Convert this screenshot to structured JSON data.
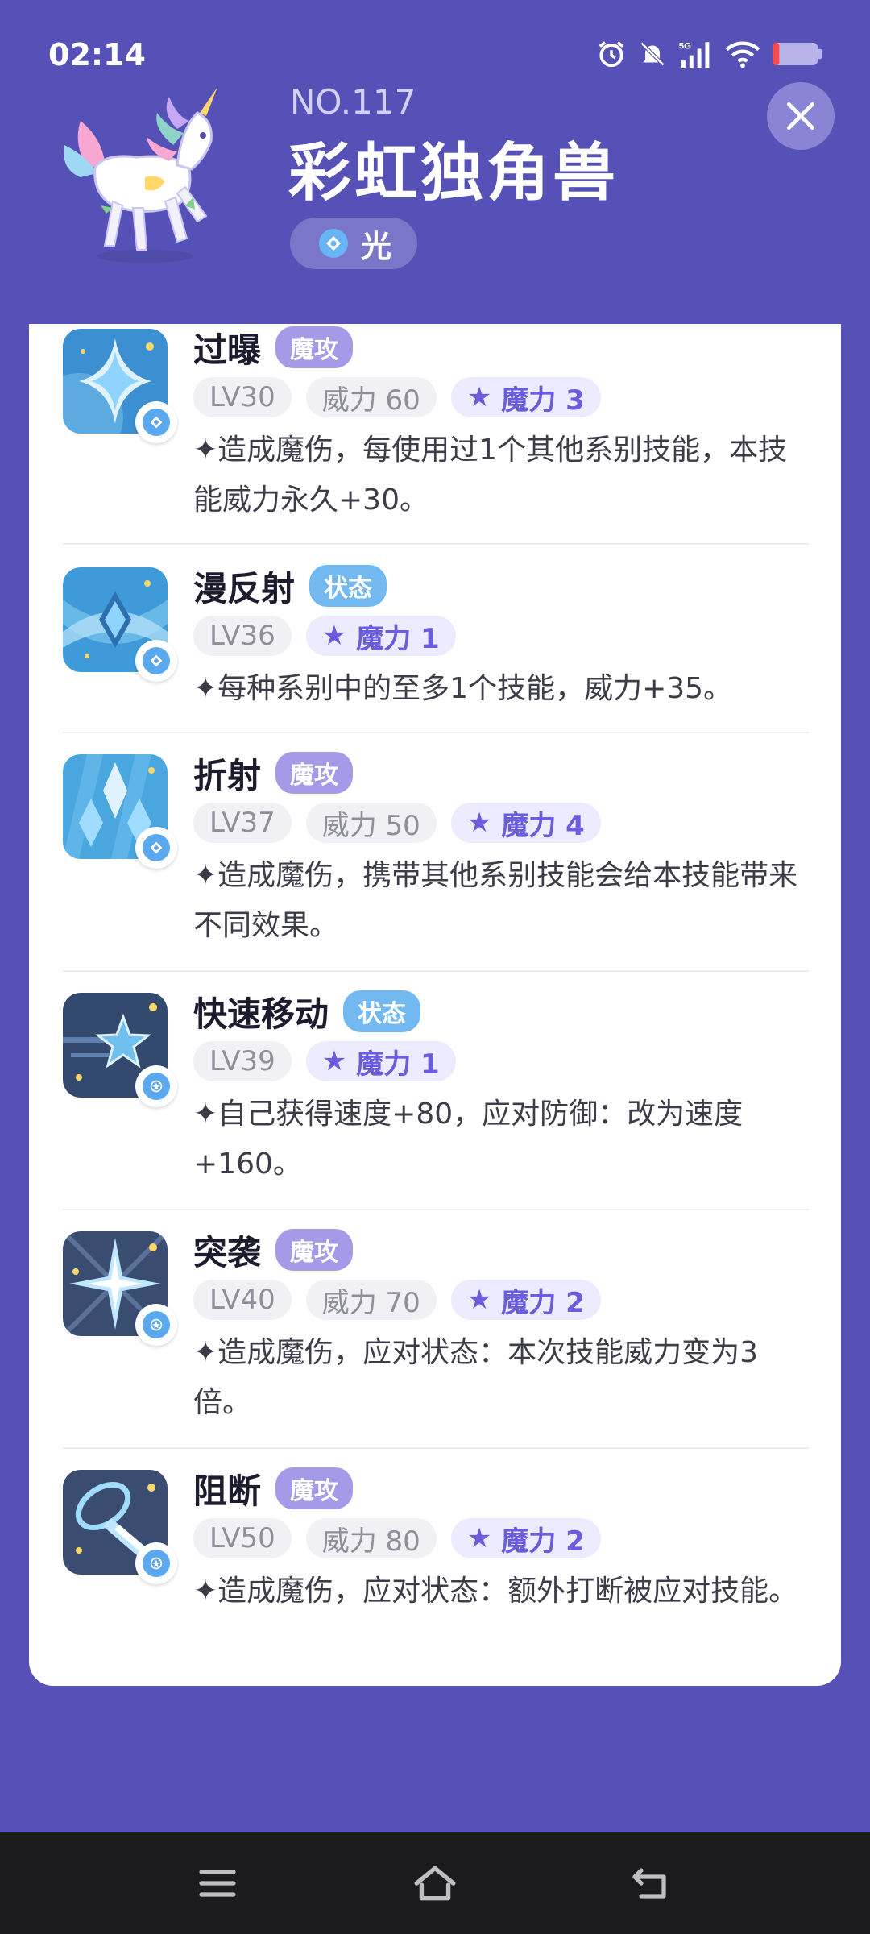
{
  "status": {
    "time": "02:14",
    "network": "5G"
  },
  "pet": {
    "number": "NO.117",
    "name": "彩虹独角兽",
    "element": "光"
  },
  "skills": [
    {
      "name": "过曝",
      "type": "魔攻",
      "level": "LV30",
      "power": "威力 60",
      "mana": "魔力 3",
      "desc": "✦造成魔伤，每使用过1个其他系别技能，本技能威力永久+30。"
    },
    {
      "name": "漫反射",
      "type": "状态",
      "level": "LV36",
      "power": "",
      "mana": "魔力 1",
      "desc": "✦每种系别中的至多1个技能，威力+35。"
    },
    {
      "name": "折射",
      "type": "魔攻",
      "level": "LV37",
      "power": "威力 50",
      "mana": "魔力 4",
      "desc": "✦造成魔伤，携带其他系别技能会给本技能带来不同效果。"
    },
    {
      "name": "快速移动",
      "type": "状态",
      "level": "LV39",
      "power": "",
      "mana": "魔力 1",
      "desc": "✦自己获得速度+80，应对防御：改为速度+160。"
    },
    {
      "name": "突袭",
      "type": "魔攻",
      "level": "LV40",
      "power": "威力 70",
      "mana": "魔力 2",
      "desc": "✦造成魔伤，应对状态：本次技能威力变为3倍。"
    },
    {
      "name": "阻断",
      "type": "魔攻",
      "level": "LV50",
      "power": "威力 80",
      "mana": "魔力 2",
      "desc": "✦造成魔伤，应对状态：额外打断被应对技能。"
    }
  ],
  "icons": {
    "alarm": "alarm-icon",
    "mute": "bell-off-icon",
    "signal": "signal-icon",
    "wifi": "wifi-icon",
    "battery": "battery-icon",
    "close": "close-icon",
    "element": "light-element-icon",
    "nav_menu": "menu-icon",
    "nav_home": "home-icon",
    "nav_back": "back-icon"
  },
  "colors": {
    "background": "#5551b6",
    "card": "#ffffff",
    "magic_badge": "#a49ae8",
    "status_badge": "#72b9f2",
    "mana_text": "#6a5cdc"
  }
}
